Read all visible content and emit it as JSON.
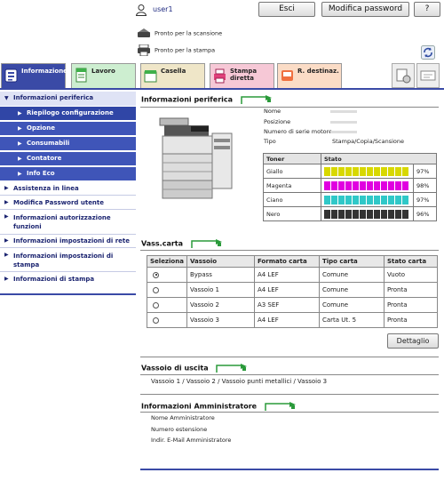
{
  "header": {
    "user": "user1",
    "logout_label": "Esci",
    "change_password_label": "Modifica password",
    "help_label": "?",
    "status_scan": "Pronto per la scansione",
    "status_print": "Pronto per la stampa"
  },
  "tabs": [
    {
      "label": "Informazione",
      "icon": "info-icon",
      "color": "#3a4aa6"
    },
    {
      "label": "Lavoro",
      "icon": "job-icon",
      "color": "#cdeed0"
    },
    {
      "label": "Casella",
      "icon": "box-icon",
      "color": "#efe6c8"
    },
    {
      "label": "Stampa diretta",
      "icon": "direct-print-icon",
      "color": "#f6c8d6"
    },
    {
      "label": "R. destinaz.",
      "icon": "address-book-icon",
      "color": "#fbdcc6"
    }
  ],
  "sidebar": {
    "device_info": "Informazioni periferica",
    "sub": {
      "config_summary": "Riepilogo configurazione",
      "option": "Opzione",
      "consumables": "Consumabili",
      "counter": "Contatore",
      "eco": "Info Eco"
    },
    "online_support": "Assistenza in linea",
    "change_password": "Modifica Password utente",
    "auth_info": "Informazioni autorizzazione funzioni",
    "network_info": "Informazioni impostazioni di rete",
    "print_settings": "Informazioni impostazioni di stampa",
    "print_info": "Informazioni di stampa"
  },
  "device": {
    "title": "Informazioni periferica",
    "name_label": "Nome",
    "location_label": "Posizione",
    "serial_label": "Numero di serie motore",
    "type_label": "Tipo",
    "type_value": "Stampa/Copia/Scansione"
  },
  "toner": {
    "header_toner": "Toner",
    "header_status": "Stato",
    "rows": [
      {
        "name": "Giallo",
        "color": "#d8d800",
        "percent": "97%"
      },
      {
        "name": "Magenta",
        "color": "#e000e0",
        "percent": "98%"
      },
      {
        "name": "Ciano",
        "color": "#30c8c8",
        "percent": "97%"
      },
      {
        "name": "Nero",
        "color": "#333333",
        "percent": "96%"
      }
    ]
  },
  "trays": {
    "title": "Vass.carta",
    "headers": [
      "Seleziona",
      "Vassoio",
      "Formato carta",
      "Tipo carta",
      "Stato carta"
    ],
    "rows": [
      {
        "selected": true,
        "tray": "Bypass",
        "size": "A4 LEF",
        "type": "Comune",
        "status": "Vuoto"
      },
      {
        "selected": false,
        "tray": "Vassoio 1",
        "size": "A4 LEF",
        "type": "Comune",
        "status": "Pronta"
      },
      {
        "selected": false,
        "tray": "Vassoio 2",
        "size": "A3 SEF",
        "type": "Comune",
        "status": "Pronta"
      },
      {
        "selected": false,
        "tray": "Vassoio 3",
        "size": "A4 LEF",
        "type": "Carta Ut. 5",
        "status": "Pronta"
      }
    ],
    "detail_label": "Dettaglio"
  },
  "output": {
    "title": "Vassoio di uscita",
    "value": "Vassoio 1 / Vassoio 2 / Vassoio punti metallici / Vassoio 3"
  },
  "admin": {
    "title": "Informazioni Amministratore",
    "name_label": "Nome Amministratore",
    "ext_label": "Numero estensione",
    "email_label": "Indir. E-Mail Amministratore"
  }
}
